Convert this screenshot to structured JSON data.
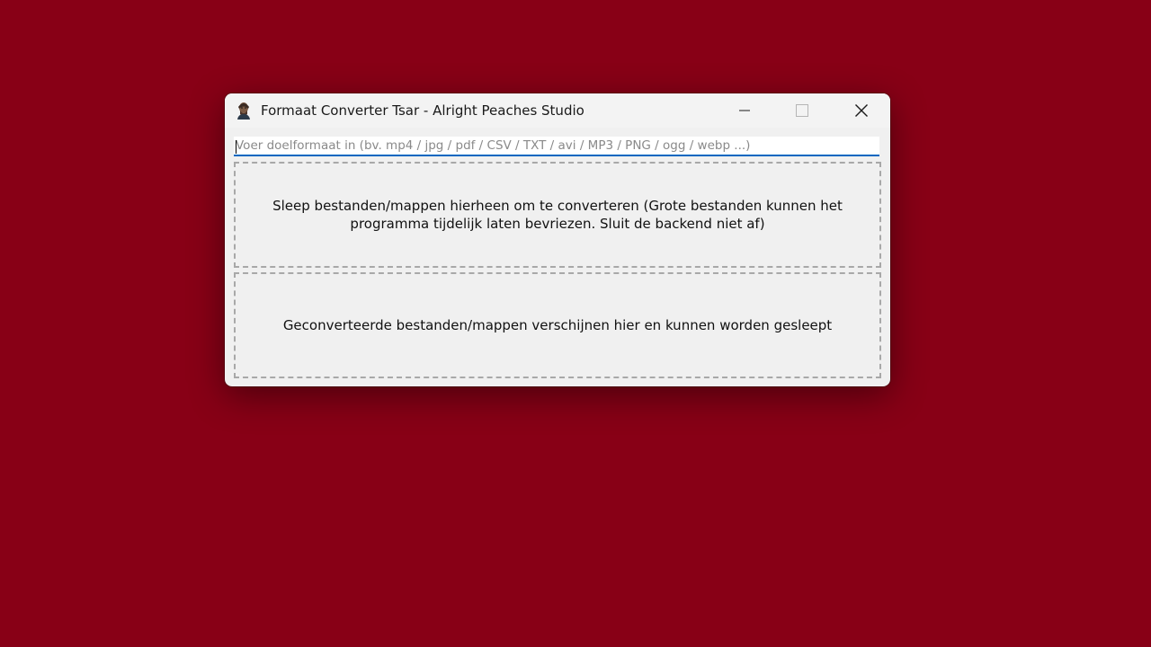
{
  "window": {
    "title": "Formaat Converter Tsar - Alright Peaches Studio",
    "app_icon": "tsar-portrait-icon",
    "controls": {
      "minimize": "minimize-icon",
      "maximize": "maximize-icon",
      "close": "close-icon"
    }
  },
  "format_input": {
    "value": "",
    "placeholder": "Voer doelformaat in (bv. mp4 / jpg / pdf / CSV / TXT / avi / MP3 / PNG / ogg / webp ...)"
  },
  "input_zone": {
    "text": "Sleep bestanden/mappen hierheen om te converteren (Grote bestanden kunnen het programma tijdelijk laten bevriezen. Sluit de backend niet af)"
  },
  "output_zone": {
    "text": "Geconverteerde bestanden/mappen verschijnen hier en kunnen worden gesleept"
  },
  "colors": {
    "desktop_background": "#880016",
    "window_background": "#f0f0f0",
    "input_accent": "#0067c0",
    "dashed_border": "#a8a8a8"
  }
}
